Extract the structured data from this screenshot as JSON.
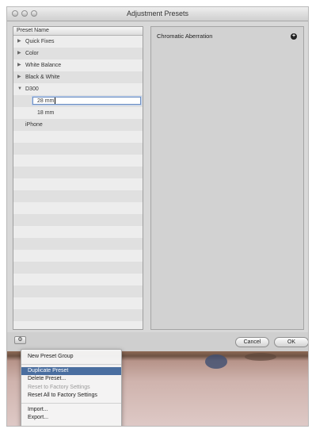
{
  "window": {
    "title": "Adjustment Presets"
  },
  "preset_list": {
    "column_header": "Preset Name",
    "items": [
      {
        "label": "Quick Fixes",
        "level": 0,
        "expandable": true,
        "expanded": false
      },
      {
        "label": "Color",
        "level": 0,
        "expandable": true,
        "expanded": false
      },
      {
        "label": "White Balance",
        "level": 0,
        "expandable": true,
        "expanded": false
      },
      {
        "label": "Black & White",
        "level": 0,
        "expandable": true,
        "expanded": false
      },
      {
        "label": "D300",
        "level": 0,
        "expandable": true,
        "expanded": true
      },
      {
        "label": "28 mm",
        "level": 1,
        "editing": true
      },
      {
        "label": "18 mm",
        "level": 1
      },
      {
        "label": "iPhone",
        "level": 0,
        "expandable": false
      }
    ]
  },
  "detail": {
    "title": "Chromatic Aberration",
    "icon": "plus-circle-icon"
  },
  "footer": {
    "gear_icon": "gear-icon",
    "cancel_label": "Cancel",
    "ok_label": "OK"
  },
  "context_menu": {
    "items": [
      {
        "label": "New Preset Group",
        "disabled": false
      },
      {
        "separator": true
      },
      {
        "label": "Duplicate Preset",
        "highlighted": true
      },
      {
        "label": "Delete Preset...",
        "disabled": false
      },
      {
        "label": "Reset to Factory Settings",
        "disabled": true
      },
      {
        "label": "Reset All to Factory Settings",
        "disabled": false
      },
      {
        "separator": true
      },
      {
        "label": "Import...",
        "disabled": false
      },
      {
        "label": "Export...",
        "disabled": false
      }
    ]
  },
  "colors": {
    "accent": "#4a6e9f",
    "window_bg": "#d8d8d8"
  }
}
